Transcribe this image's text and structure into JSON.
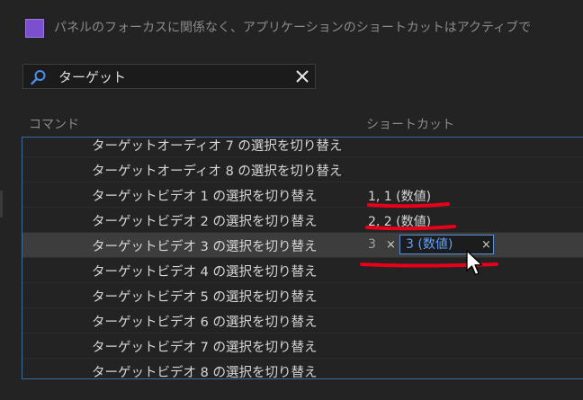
{
  "panel_note": "パネルのフォーカスに関係なく、アプリケーションのショートカットはアクティブで",
  "search": {
    "value": "ターゲット",
    "clear_icon": "close-icon",
    "search_icon": "search-icon"
  },
  "columns": {
    "command": "コマンド",
    "shortcut": "ショートカット"
  },
  "rows": [
    {
      "label": "ターゲットオーディオ 7 の選択を切り替え",
      "shortcut": ""
    },
    {
      "label": "ターゲットオーディオ 8 の選択を切り替え",
      "shortcut": ""
    },
    {
      "label": "ターゲットビデオ 1 の選択を切り替え",
      "shortcut": "1, 1 (数値)"
    },
    {
      "label": "ターゲットビデオ 2 の選択を切り替え",
      "shortcut": "2, 2 (数値)"
    },
    {
      "label": "ターゲットビデオ 3 の選択を切り替え",
      "shortcut": "",
      "key_plain": "3",
      "key_edit": "3 (数値)"
    },
    {
      "label": "ターゲットビデオ 4 の選択を切り替え",
      "shortcut": ""
    },
    {
      "label": "ターゲットビデオ 5 の選択を切り替え",
      "shortcut": ""
    },
    {
      "label": "ターゲットビデオ 6 の選択を切り替え",
      "shortcut": ""
    },
    {
      "label": "ターゲットビデオ 7 の選択を切り替え",
      "shortcut": ""
    },
    {
      "label": "ターゲットビデオ 8 の選択を切り替え",
      "shortcut": ""
    }
  ],
  "chip_remove_glyph": "×",
  "selected_row_index": 4,
  "colors": {
    "accent": "#5ea1ff",
    "swatch": "#7b4fd0",
    "annotation": "#e8001a"
  }
}
